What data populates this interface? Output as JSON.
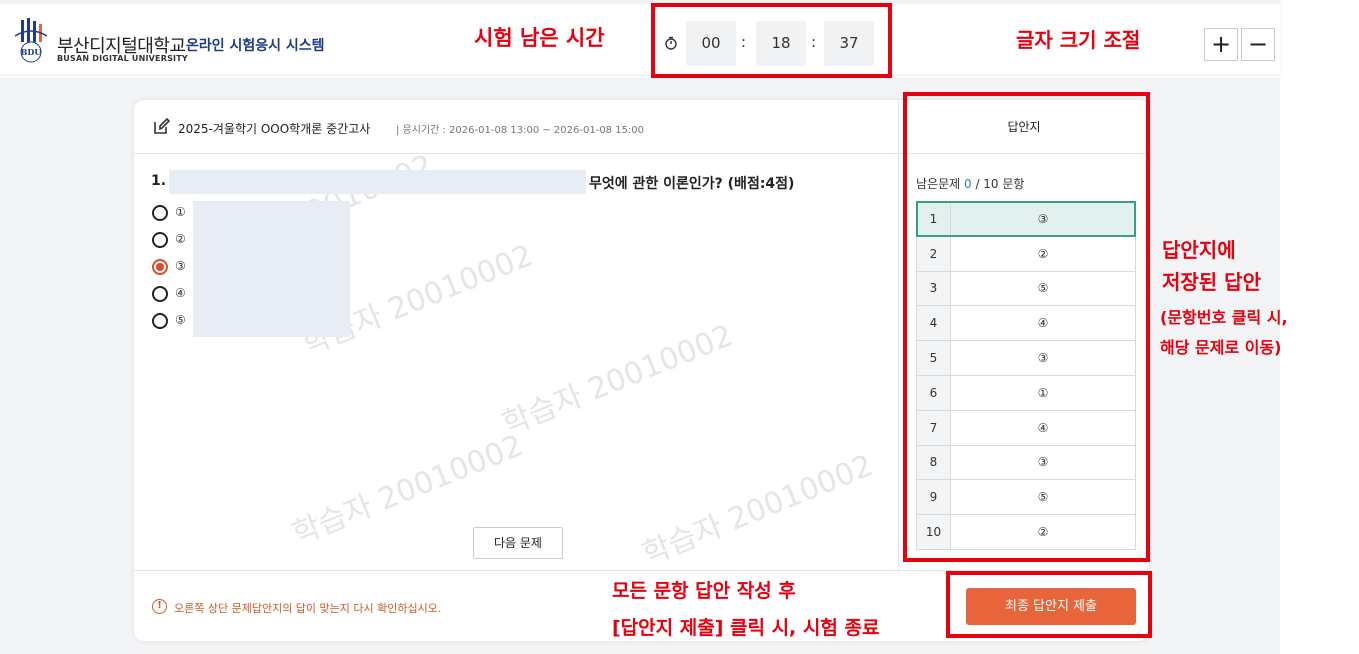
{
  "header": {
    "logo_text_kr": "부산디지털대학교",
    "logo_text_en": "BUSAN DIGITAL UNIVERSITY",
    "logo_mark": "BDU",
    "system_title": "온라인 시험응시 시스템",
    "timer": {
      "hours": "00",
      "minutes": "18",
      "seconds": "37",
      "sep": ":"
    },
    "font_increase": "+",
    "font_decrease": "−"
  },
  "annotations": {
    "timer_label": "시험 남은 시간",
    "font_size_label": "글자 크기 조절",
    "answer_sheet_line1": "답안지에",
    "answer_sheet_line2": "저장된 답안",
    "answer_sheet_line3": "(문항번호 클릭 시,",
    "answer_sheet_line4": "해당 문제로 이동)",
    "submit_line1": "모든 문항 답안 작성 후",
    "submit_line2": "[답안지 제출] 클릭 시, 시험 종료"
  },
  "exam": {
    "name": "2025-겨울학기 OOO학개론 중간고사",
    "period": "| 응시기간 : 2026-01-08 13:00 ~ 2026-01-08 15:00"
  },
  "question": {
    "number": "1.",
    "text_tail": "무엇에 관한 이론인가? (배점:4점)",
    "options": [
      "①",
      "②",
      "③",
      "④",
      "⑤"
    ],
    "selected_index": 2,
    "watermark": "학습자 20010002",
    "next_label": "다음 문제"
  },
  "footer": {
    "warning_icon": "!",
    "warning": "오른쪽 상단 문제답안지의 답이 맞는지 다시 확인하십시오.",
    "submit_label": "최종 답안지 제출"
  },
  "answer_sheet": {
    "title": "답안지",
    "remain_prefix": "남은문제 ",
    "remain_count": "0",
    "remain_suffix": " / 10 문항",
    "rows": [
      {
        "no": "1",
        "ans": "③"
      },
      {
        "no": "2",
        "ans": "②"
      },
      {
        "no": "3",
        "ans": "⑤"
      },
      {
        "no": "4",
        "ans": "④"
      },
      {
        "no": "5",
        "ans": "③"
      },
      {
        "no": "6",
        "ans": "①"
      },
      {
        "no": "7",
        "ans": "④"
      },
      {
        "no": "8",
        "ans": "③"
      },
      {
        "no": "9",
        "ans": "⑤"
      },
      {
        "no": "10",
        "ans": "②"
      }
    ]
  },
  "colors": {
    "annotation_red": "#e8000f",
    "accent_orange": "#e8643a",
    "system_title_blue": "#1f3a8a",
    "active_row_teal": "#3d9e88"
  }
}
